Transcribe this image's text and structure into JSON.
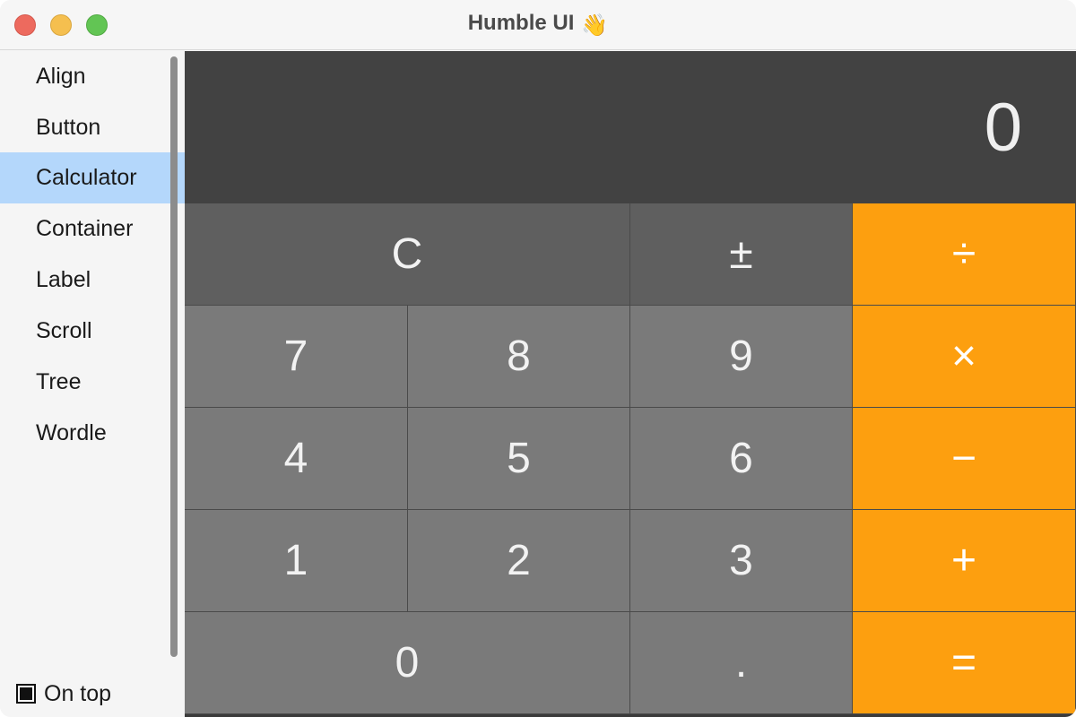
{
  "window": {
    "title": "Humble UI",
    "title_emoji": "👋"
  },
  "sidebar": {
    "items": [
      {
        "label": "Align"
      },
      {
        "label": "Button"
      },
      {
        "label": "Calculator",
        "selected": true
      },
      {
        "label": "Container"
      },
      {
        "label": "Label"
      },
      {
        "label": "Scroll"
      },
      {
        "label": "Tree"
      },
      {
        "label": "Wordle"
      }
    ],
    "on_top": {
      "label": "On top",
      "checked": true
    }
  },
  "calculator": {
    "display": "0",
    "keys": {
      "clear": "C",
      "plus_minus": "±",
      "divide": "÷",
      "seven": "7",
      "eight": "8",
      "nine": "9",
      "multiply": "×",
      "four": "4",
      "five": "5",
      "six": "6",
      "minus": "−",
      "one": "1",
      "two": "2",
      "three": "3",
      "plus": "+",
      "zero": "0",
      "decimal": ".",
      "equals": "="
    }
  },
  "colors": {
    "accent_selected": "#b4d7fb",
    "operator": "#fd9f0f",
    "function_key": "#5f5f5f",
    "number_key": "#7a7a7a",
    "display_bg": "#424242"
  }
}
